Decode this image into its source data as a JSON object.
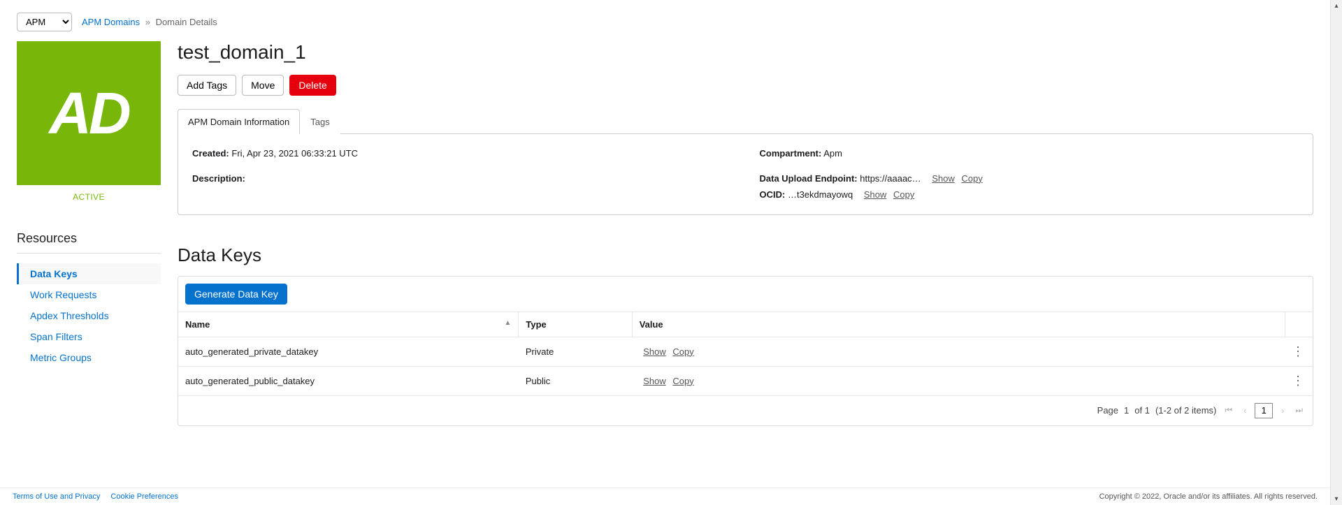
{
  "selector": {
    "value": "APM"
  },
  "breadcrumb": {
    "root": "APM Domains",
    "current": "Domain Details"
  },
  "tile": {
    "letters": "AD",
    "status": "ACTIVE"
  },
  "resources": {
    "heading": "Resources",
    "items": [
      {
        "label": "Data Keys",
        "active": true
      },
      {
        "label": "Work Requests",
        "active": false
      },
      {
        "label": "Apdex Thresholds",
        "active": false
      },
      {
        "label": "Span Filters",
        "active": false
      },
      {
        "label": "Metric Groups",
        "active": false
      }
    ]
  },
  "title": "test_domain_1",
  "buttons": {
    "add_tags": "Add Tags",
    "move": "Move",
    "delete": "Delete"
  },
  "tabs": {
    "info": "APM Domain Information",
    "tags": "Tags"
  },
  "info": {
    "created_label": "Created:",
    "created_value": "Fri, Apr 23, 2021 06:33:21 UTC",
    "description_label": "Description:",
    "compartment_label": "Compartment:",
    "compartment_value": "Apm",
    "upload_label": "Data Upload Endpoint:",
    "upload_value": "https://aaaac…",
    "ocid_label": "OCID:",
    "ocid_value": "…t3ekdmayowq",
    "show": "Show",
    "copy": "Copy"
  },
  "keys": {
    "heading": "Data Keys",
    "generate": "Generate Data Key",
    "cols": {
      "name": "Name",
      "type": "Type",
      "value": "Value"
    },
    "rows": [
      {
        "name": "auto_generated_private_datakey",
        "type": "Private"
      },
      {
        "name": "auto_generated_public_datakey",
        "type": "Public"
      }
    ],
    "show": "Show",
    "copy": "Copy"
  },
  "pager": {
    "page_label": "Page",
    "current": "1",
    "of": "of 1",
    "range": "(1-2 of 2 items)"
  },
  "footer": {
    "terms": "Terms of Use and Privacy",
    "cookie": "Cookie Preferences",
    "copyright": "Copyright © 2022, Oracle and/or its affiliates. All rights reserved."
  }
}
